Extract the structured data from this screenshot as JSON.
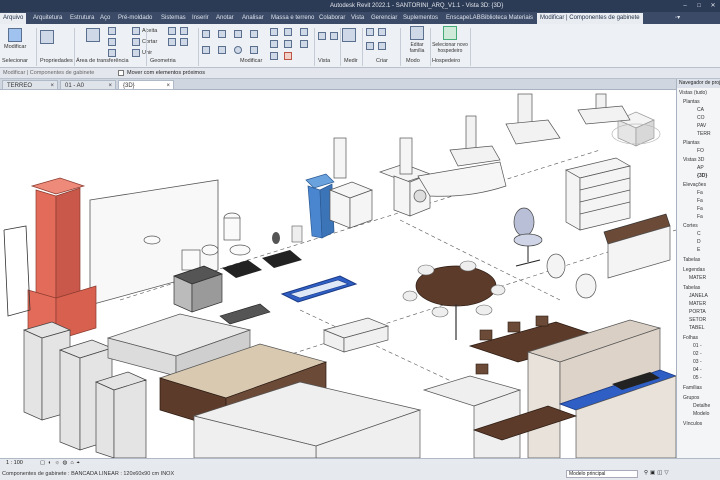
{
  "app": {
    "window_title": "Autodesk Revit 2022.1 - SANTORINI_ARQ_V1.1 - Vista 3D: {3D}"
  },
  "ribbon_tabs": [
    {
      "label": "Arquivo",
      "active": true
    },
    {
      "label": "Arquitetura"
    },
    {
      "label": "Estrutura"
    },
    {
      "label": "Aço"
    },
    {
      "label": "Pré-moldado"
    },
    {
      "label": "Sistemas"
    },
    {
      "label": "Inserir"
    },
    {
      "label": "Anotar"
    },
    {
      "label": "Analisar"
    },
    {
      "label": "Massa e terreno"
    },
    {
      "label": "Colaborar"
    },
    {
      "label": "Vista"
    },
    {
      "label": "Gerenciar"
    },
    {
      "label": "Suplementos"
    },
    {
      "label": "EnscapeLAB"
    },
    {
      "label": "Biblioteca Materiais"
    },
    {
      "label": "Modificar | Componentes de gabinete",
      "context": true
    }
  ],
  "ribbon": {
    "modify": "Modificar",
    "select_panel": "Selecionar",
    "properties_panel": "Propriedades",
    "clipboard_panel": "Área de transferência",
    "geometry_panel": "Geometria",
    "modify_panel": "Modificar",
    "view_panel": "Vista",
    "measure_panel": "Medir",
    "create_panel": "Criar",
    "mode_panel": "Modo",
    "host_panel": "Hospedeiro",
    "cut_label": "Cortar",
    "join_label": "Unir",
    "cope_label": "Aceita",
    "edit_family": "Editar família",
    "pick_new_host": "Selecionar novo hospedeiro"
  },
  "options_bar": {
    "context": "Modificar | Componentes de gabinete",
    "checkbox_label": "Mover com elementos próximos"
  },
  "view_tabs": [
    {
      "label": "TERREO"
    },
    {
      "label": "01 - A0"
    },
    {
      "label": "{3D}",
      "active": true
    }
  ],
  "project_browser": {
    "title": "Navegador de projeto",
    "items": [
      "Vistas (tudo)",
      "Plantas",
      "CA",
      "CO",
      "PAV",
      "TERR",
      "Plantas",
      "FO",
      "Vistas 3D",
      "AP",
      "{3D}",
      "Elevações",
      "Fa",
      "Fa",
      "Fa",
      "Fa",
      "Cortes",
      "C",
      "D",
      "E",
      "Tabelas",
      "Legendas",
      "MATER",
      "Tabelas",
      "JANELA",
      "MATER",
      "PORTA",
      "SETOR",
      "TABEL",
      "Folhas",
      "01 -",
      "02 -",
      "03 -",
      "04 -",
      "05 -",
      "Famílias",
      "Grupos",
      "Detalhe",
      "Modelo",
      "Vínculos"
    ]
  },
  "view_control_bar": {
    "scale": "1 : 100"
  },
  "status_bar": {
    "text": "Componentes de gabinete : BANCADA LINEAR : 120x60x90 cm INOX",
    "model": "Modelo principal"
  },
  "colors": {
    "title_bg": "#2b3a55",
    "ribbon_bg": "#edf0f4",
    "selection_blue": "#2f5fc4",
    "bbq_red": "#e36b5a",
    "bin_blue": "#4a86cf",
    "wood_dark": "#5c3b2a"
  }
}
